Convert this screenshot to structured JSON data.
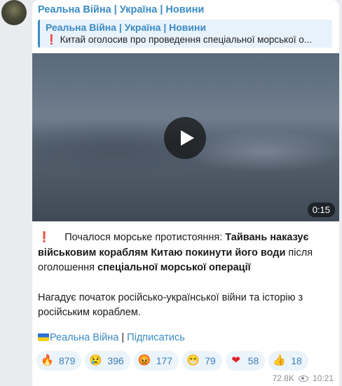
{
  "post": {
    "channel_name": "Реальна Війна | Україна | Новини",
    "reply": {
      "title": "Реальна Війна | Україна | Новини",
      "prefix": "❗",
      "text": "Китай оголосив про проведення спеціальної морської о..."
    },
    "video": {
      "duration": "0:15"
    },
    "body": {
      "p1_prefix": "❗",
      "p1_a": "Почалося морське протистояння: ",
      "p1_b": "Тайвань наказує військовим кораблям Китаю покинути його води",
      "p1_c": " після оголошення ",
      "p1_d": "спеціальної морської операції",
      "p2": "Нагадує початок російсько-української війни та історію з російським кораблем."
    },
    "footer": {
      "channel_link": "Реальна Війна",
      "separator": " | ",
      "subscribe_link": "Підписатись"
    },
    "reactions": [
      {
        "emoji": "🔥",
        "count": "879",
        "icon": "fire-icon"
      },
      {
        "emoji": "😢",
        "count": "396",
        "icon": "crying-face-icon"
      },
      {
        "emoji": "😡",
        "count": "177",
        "icon": "angry-face-icon"
      },
      {
        "emoji": "😁",
        "count": "79",
        "icon": "grinning-face-icon"
      },
      {
        "emoji": "❤",
        "count": "58",
        "icon": "heart-icon"
      },
      {
        "emoji": "👍",
        "count": "18",
        "icon": "thumbs-up-icon"
      }
    ],
    "views": "72.8K",
    "time": "10:21"
  }
}
